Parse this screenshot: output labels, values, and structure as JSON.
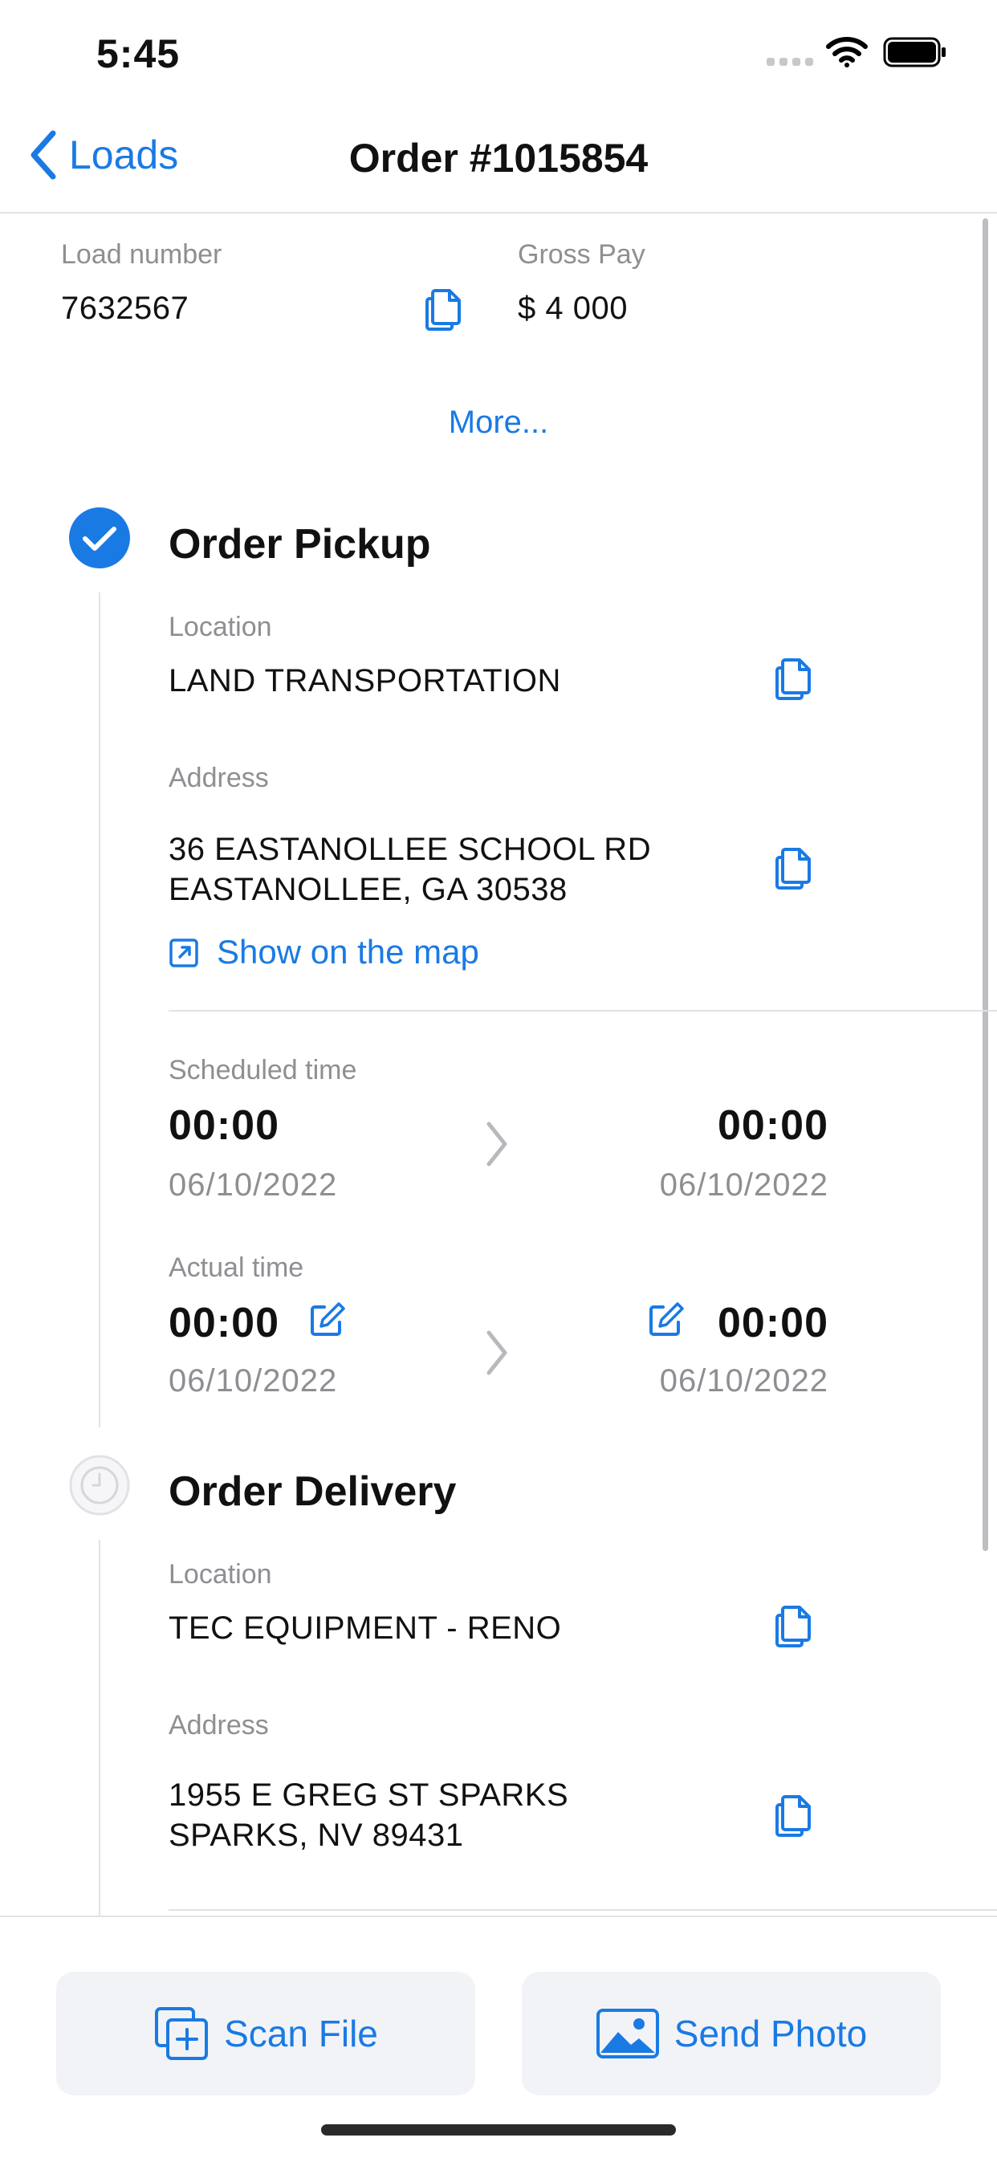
{
  "status_bar": {
    "time": "5:45"
  },
  "nav": {
    "back_label": "Loads",
    "title": "Order #1015854"
  },
  "summary": {
    "load_number_label": "Load number",
    "load_number_value": "7632567",
    "gross_pay_label": "Gross Pay",
    "gross_pay_value": "$ 4 000",
    "more_label": "More..."
  },
  "pickup": {
    "title": "Order Pickup",
    "location_label": "Location",
    "location_value": "LAND TRANSPORTATION",
    "address_label": "Address",
    "address_line1": "36 EASTANOLLEE SCHOOL RD",
    "address_line2": "EASTANOLLEE, GA 30538",
    "map_link": "Show on the map",
    "scheduled_label": "Scheduled time",
    "scheduled_start_time": "00:00",
    "scheduled_start_date": "06/10/2022",
    "scheduled_end_time": "00:00",
    "scheduled_end_date": "06/10/2022",
    "actual_label": "Actual time",
    "actual_start_time": "00:00",
    "actual_start_date": "06/10/2022",
    "actual_end_time": "00:00",
    "actual_end_date": "06/10/2022"
  },
  "delivery": {
    "title": "Order Delivery",
    "location_label": "Location",
    "location_value": "TEC EQUIPMENT - RENO",
    "address_label": "Address",
    "address_line1": "1955 E GREG ST SPARKS",
    "address_line2": "SPARKS, NV 89431"
  },
  "actions": {
    "scan_label": "Scan File",
    "photo_label": "Send Photo"
  },
  "colors": {
    "accent": "#1a7ae4",
    "muted": "#8e8e93",
    "separator": "#e2e2e6",
    "button_bg": "#f2f3f7"
  },
  "icons": [
    "wifi-icon",
    "battery-icon",
    "chevron-left-icon",
    "copy-icon",
    "checkmark-circle-icon",
    "clock-icon",
    "external-link-icon",
    "chevron-right-icon",
    "edit-icon",
    "scan-add-icon",
    "photo-icon"
  ]
}
